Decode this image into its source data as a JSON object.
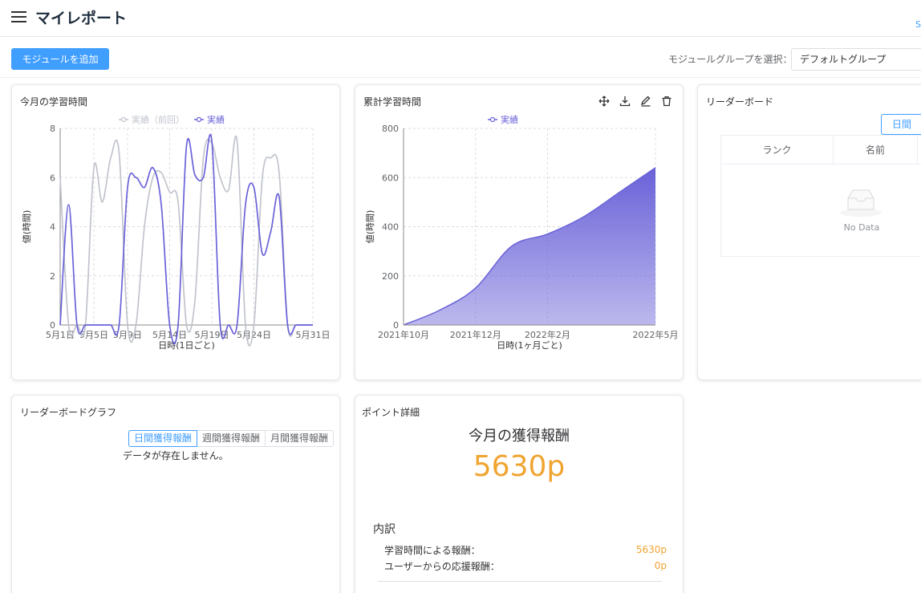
{
  "header": {
    "title": "マイレポート",
    "corner_text": "S"
  },
  "toolbar": {
    "add_module_label": "モジュールを追加",
    "group_select_label": "モジュールグループを選択：",
    "group_select_value": "デフォルトグループ"
  },
  "monthly_card": {
    "title": "今月の学習時間",
    "chart_data": {
      "type": "line",
      "xlabel": "日時(1日ごと)",
      "ylabel": "値(時間)",
      "ylim": [
        0,
        8
      ],
      "x_ticks": [
        "5月1日",
        "5月5日",
        "5月9日",
        "5月14日",
        "5月19日",
        "5月24日",
        "5月31日"
      ],
      "y_ticks": [
        "0",
        "2",
        "4",
        "6",
        "8"
      ],
      "x": [
        1,
        2,
        3,
        4,
        5,
        6,
        7,
        8,
        9,
        10,
        11,
        12,
        13,
        14,
        15,
        16,
        17,
        18,
        19,
        20,
        21,
        22,
        23,
        24,
        25,
        26,
        27,
        28,
        29,
        30,
        31
      ],
      "series": [
        {
          "name": "実績（前回）",
          "color": "#c0c4cc",
          "values": [
            6.0,
            0,
            0,
            0,
            6.4,
            5.0,
            6.8,
            7.0,
            0,
            0,
            4.0,
            6.0,
            6.2,
            5.4,
            5.0,
            0,
            1.0,
            6.8,
            7.4,
            6.0,
            5.5,
            7.5,
            0,
            0,
            6.0,
            6.8,
            6.2,
            0,
            0,
            0,
            0
          ]
        },
        {
          "name": "実績",
          "color": "#6a62d8",
          "values": [
            0,
            4.9,
            0,
            0,
            0,
            0,
            0,
            0,
            5.6,
            6.0,
            5.6,
            6.4,
            4.9,
            0,
            0,
            7.3,
            6.1,
            6.0,
            7.5,
            0,
            0,
            0,
            4.9,
            5.6,
            2.9,
            3.8,
            5.2,
            0,
            0,
            0,
            0
          ]
        }
      ],
      "legend_position": "top"
    }
  },
  "cumulative_card": {
    "title": "累計学習時間",
    "tool_icons": [
      "move-icon",
      "download-icon",
      "edit-icon",
      "trash-icon"
    ],
    "chart_data": {
      "type": "area",
      "xlabel": "日時(1ヶ月ごと)",
      "ylabel": "値(時間)",
      "ylim": [
        0,
        800
      ],
      "x_ticks": [
        "2021年10月",
        "2021年12月",
        "2022年2月",
        "2022年5月"
      ],
      "y_ticks": [
        "0",
        "200",
        "400",
        "600",
        "800"
      ],
      "x": [
        "2021年10月",
        "2021年11月",
        "2021年12月",
        "2022年1月",
        "2022年2月",
        "2022年3月",
        "2022年4月",
        "2022年5月"
      ],
      "series": [
        {
          "name": "実績",
          "color": "#6a62d8",
          "values": [
            0,
            60,
            150,
            320,
            370,
            440,
            540,
            640
          ]
        }
      ],
      "legend_position": "top"
    }
  },
  "leaderboard_card": {
    "title": "リーダーボード",
    "tab_daily": "日間",
    "col_rank": "ランク",
    "col_name": "名前",
    "empty_text": "No Data"
  },
  "lb_graph_card": {
    "title": "リーダーボードグラフ",
    "seg_daily": "日間獲得報酬",
    "seg_weekly": "週間獲得報酬",
    "seg_monthly": "月間獲得報酬",
    "no_data": "データが存在しません。"
  },
  "points_card": {
    "title": "ポイント詳細",
    "heading": "今月の獲得報酬",
    "value": "5630p",
    "breakdown_title": "内訳",
    "rows": [
      {
        "label": "学習時間による報酬：",
        "value": "5630p"
      },
      {
        "label": "ユーザーからの応援報酬：",
        "value": "0p"
      }
    ]
  },
  "colors": {
    "accent": "#409eff",
    "primary_series": "#6a62d8",
    "previous_series": "#c0c4cc",
    "points": "#f0a430"
  }
}
